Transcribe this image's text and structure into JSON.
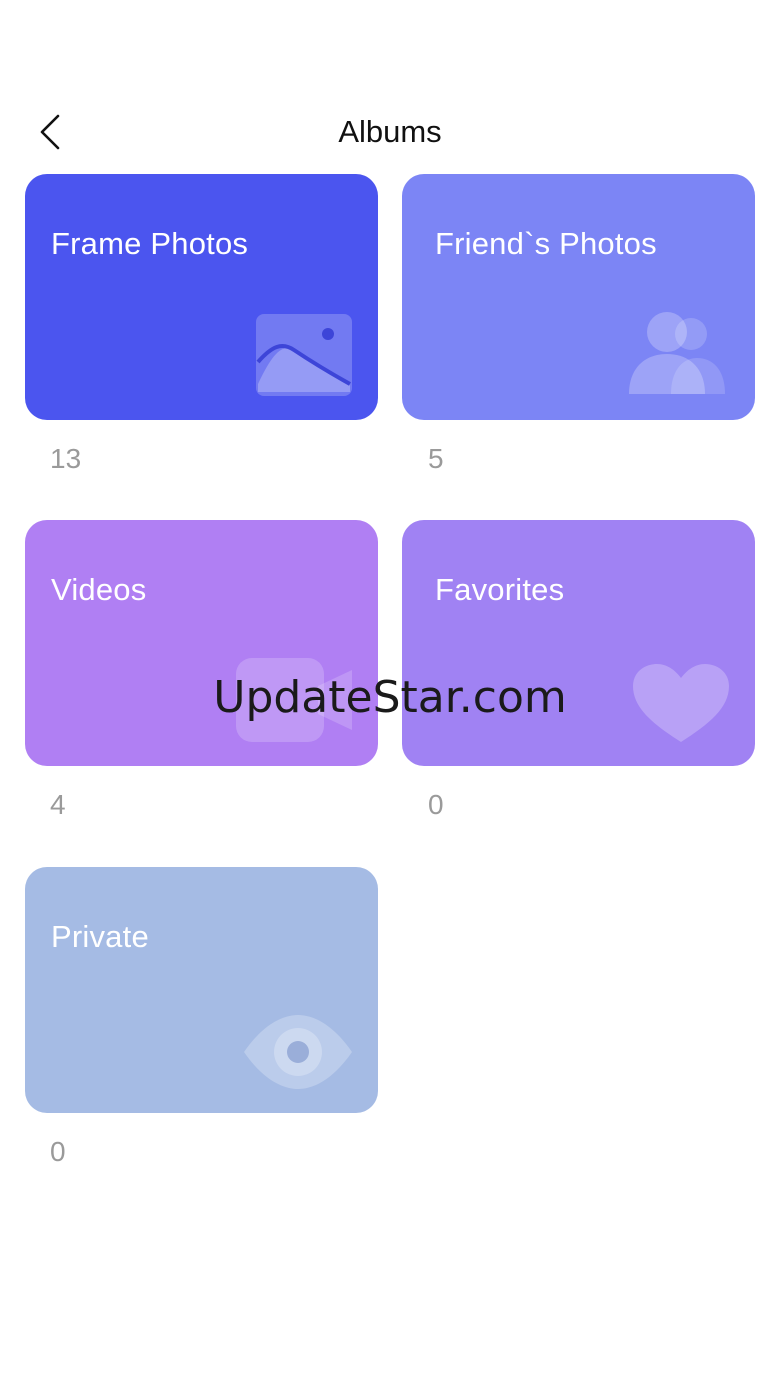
{
  "header": {
    "title": "Albums",
    "back_icon": "chevron-left-icon"
  },
  "albums": [
    {
      "name": "Frame Photos",
      "count": "13",
      "color": "#4b55ef",
      "icon": "image-icon"
    },
    {
      "name": "Friend`s Photos",
      "count": "5",
      "color": "#7c85f5",
      "icon": "users-icon"
    },
    {
      "name": "Videos",
      "count": "4",
      "color": "#b07ff3",
      "icon": "video-camera-icon"
    },
    {
      "name": "Favorites",
      "count": "0",
      "color": "#a082f3",
      "icon": "heart-icon"
    },
    {
      "name": "Private",
      "count": "0",
      "color": "#a5bbe4",
      "icon": "eye-icon"
    }
  ],
  "watermark": "UpdateStar.com"
}
